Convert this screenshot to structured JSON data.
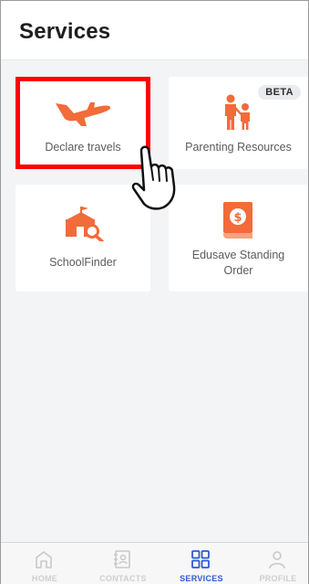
{
  "header": {
    "title": "Services"
  },
  "services": [
    {
      "label": "Declare travels",
      "icon": "airplane-icon"
    },
    {
      "label": "Parenting Resources",
      "icon": "parent-child-icon",
      "badge": "BETA"
    },
    {
      "label": "SchoolFinder",
      "icon": "school-search-icon"
    },
    {
      "label": "Edusave Standing Order",
      "icon": "edusave-book-icon"
    }
  ],
  "tabs": [
    {
      "label": "HOME",
      "icon": "home-icon",
      "active": false
    },
    {
      "label": "CONTACTS",
      "icon": "contacts-icon",
      "active": false
    },
    {
      "label": "SERVICES",
      "icon": "services-grid-icon",
      "active": true
    },
    {
      "label": "PROFILE",
      "icon": "profile-icon",
      "active": false
    }
  ],
  "colors": {
    "accent": "#f26b3a",
    "tab_active": "#2d5bd1",
    "tab_inactive": "#cfcfcf",
    "highlight": "#ff0000",
    "background": "#f2f4f6"
  }
}
